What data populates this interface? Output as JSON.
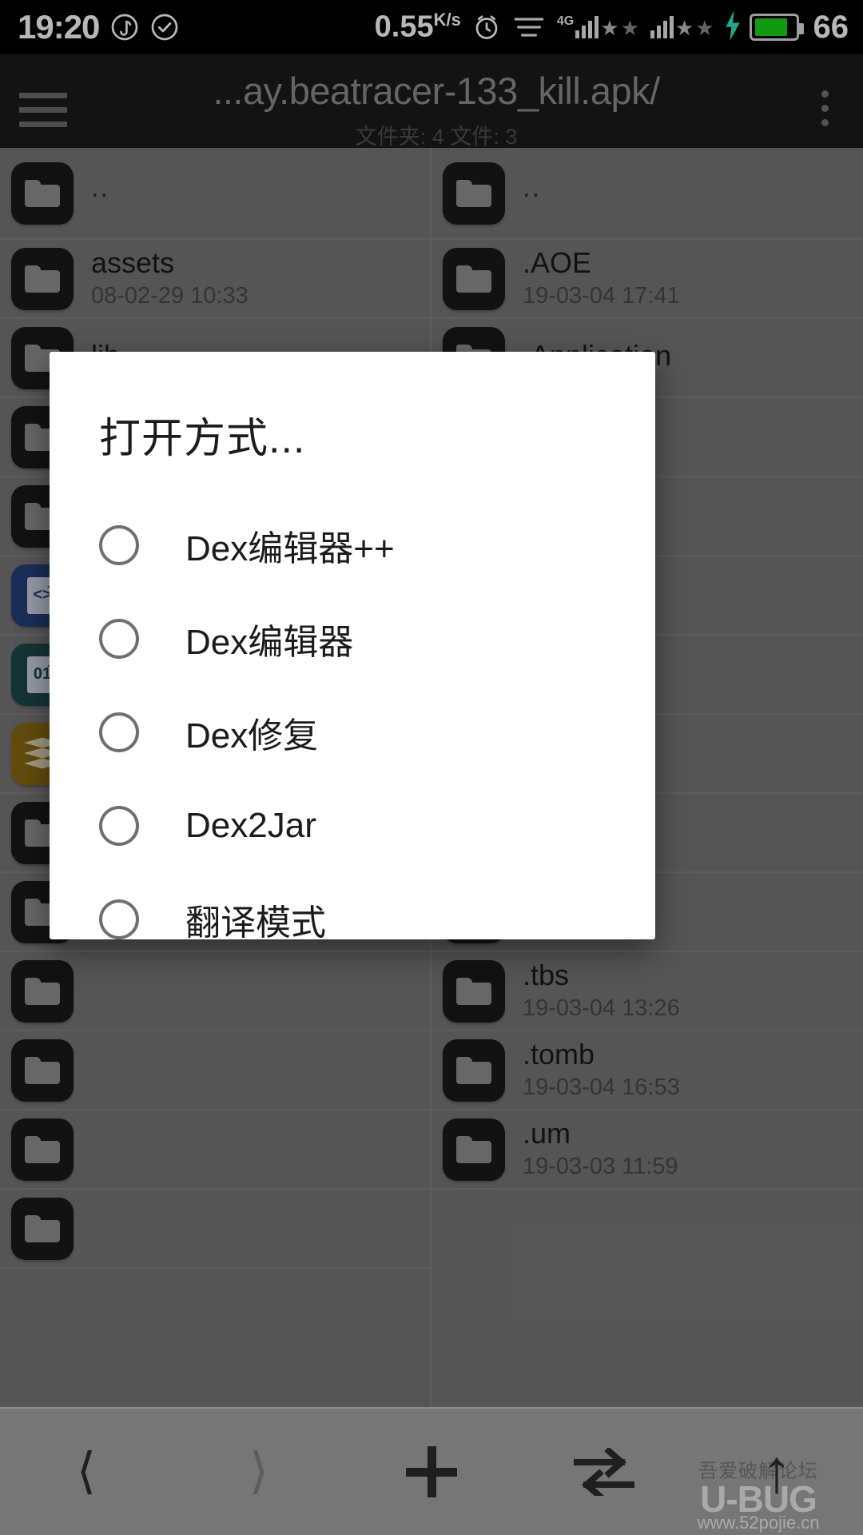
{
  "status_bar": {
    "time": "19:20",
    "music_icon": "music-note-icon",
    "check_icon": "check-circle-icon",
    "network_speed": "0.55",
    "network_speed_unit_top": "K",
    "network_speed_unit_bottom": "s",
    "alarm_icon": "alarm-clock-icon",
    "menu_icon": "list-lines-icon",
    "network_type": "4G",
    "battery_percent": "66",
    "charging_icon": "lightning-bolt-icon",
    "battery_color": "#18d618"
  },
  "title_bar": {
    "menu_icon": "hamburger-menu-icon",
    "path": "...ay.beatracer-133_kill.apk/",
    "subtitle": "文件夹: 4  文件: 3",
    "overflow_icon": "more-vertical-icon"
  },
  "left_pane": {
    "rows": [
      {
        "name": "..",
        "date": "",
        "icon": "folder-icon",
        "kind": "folder"
      },
      {
        "name": "assets",
        "date": "08-02-29 10:33",
        "icon": "folder-icon",
        "kind": "folder"
      },
      {
        "name": "lib",
        "date": "",
        "icon": "folder-icon",
        "kind": "folder"
      },
      {
        "name": "",
        "date": "",
        "icon": "folder-icon",
        "kind": "folder"
      },
      {
        "name": "",
        "date": "",
        "icon": "folder-icon",
        "kind": "folder"
      },
      {
        "name": "",
        "date": "",
        "icon": "xml-file-icon",
        "kind": "xml"
      },
      {
        "name": "",
        "date": "",
        "icon": "dex-file-icon",
        "kind": "dex"
      },
      {
        "name": "",
        "date": "",
        "icon": "archive-layers-icon",
        "kind": "archive"
      },
      {
        "name": "",
        "date": "",
        "icon": "folder-icon",
        "kind": "folder"
      },
      {
        "name": "",
        "date": "",
        "icon": "folder-icon",
        "kind": "folder"
      },
      {
        "name": "",
        "date": "",
        "icon": "folder-icon",
        "kind": "folder"
      },
      {
        "name": "",
        "date": "",
        "icon": "folder-icon",
        "kind": "folder"
      },
      {
        "name": "",
        "date": "",
        "icon": "folder-icon",
        "kind": "folder"
      },
      {
        "name": "",
        "date": "",
        "icon": "folder-icon",
        "kind": "folder"
      }
    ]
  },
  "right_pane": {
    "rows": [
      {
        "name": "..",
        "date": "",
        "icon": "folder-icon",
        "kind": "folder"
      },
      {
        "name": ".AOE",
        "date": "19-03-04 17:41",
        "icon": "folder-icon",
        "kind": "folder"
      },
      {
        "name": ".Application",
        "date": "",
        "icon": "folder-icon",
        "kind": "folder"
      },
      {
        "name": "",
        "date": "",
        "icon": "folder-icon",
        "kind": "folder"
      },
      {
        "name": "",
        "date": "",
        "icon": "folder-icon",
        "kind": "folder"
      },
      {
        "name": "",
        "date": "",
        "icon": "folder-icon",
        "kind": "folder"
      },
      {
        "name": "",
        "date": "",
        "icon": "folder-icon",
        "kind": "folder"
      },
      {
        "name": "",
        "date": "",
        "icon": "folder-icon",
        "kind": "folder"
      },
      {
        "name": "",
        "date": "",
        "icon": "folder-icon",
        "kind": "folder"
      },
      {
        "name": "",
        "date": "",
        "icon": "folder-icon",
        "kind": "folder"
      },
      {
        "name": ".tbs",
        "date": "19-03-04 13:26",
        "icon": "folder-icon",
        "kind": "folder"
      },
      {
        "name": ".tomb",
        "date": "19-03-04 16:53",
        "icon": "folder-icon",
        "kind": "folder"
      },
      {
        "name": ".um",
        "date": "19-03-03 11:59",
        "icon": "folder-icon",
        "kind": "folder"
      }
    ]
  },
  "dialog": {
    "title": "打开方式...",
    "options": [
      {
        "label": "Dex编辑器++",
        "selected": false
      },
      {
        "label": "Dex编辑器",
        "selected": false
      },
      {
        "label": "Dex修复",
        "selected": false
      },
      {
        "label": "Dex2Jar",
        "selected": false
      },
      {
        "label": "翻译模式",
        "selected": false
      }
    ]
  },
  "bottom_nav": {
    "items": [
      {
        "icon": "chevron-left-icon",
        "state": "enabled"
      },
      {
        "icon": "chevron-right-icon",
        "state": "disabled"
      },
      {
        "icon": "plus-icon",
        "state": "enabled"
      },
      {
        "icon": "swap-arrows-icon",
        "state": "enabled"
      },
      {
        "icon": "arrow-up-icon",
        "state": "enabled"
      }
    ]
  },
  "watermark": {
    "cn": "吾爱破解论坛",
    "brand": "U-BUG",
    "url": "www.52pojie.cn"
  }
}
